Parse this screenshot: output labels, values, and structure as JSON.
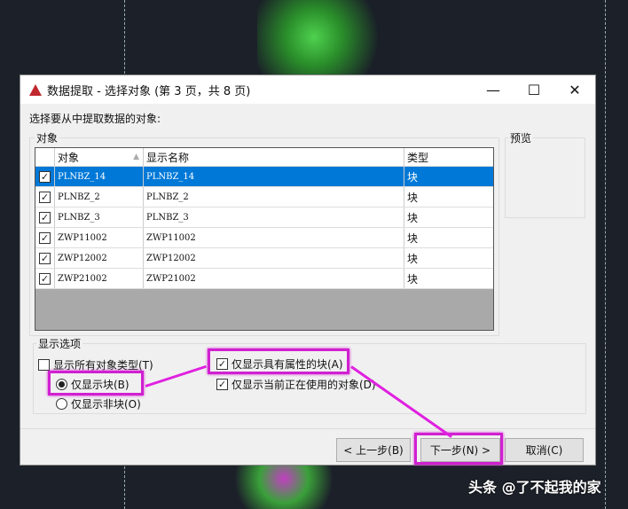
{
  "dialog": {
    "title": "数据提取 - 选择对象 (第 3 页，共 8 页)",
    "prompt": "选择要从中提取数据的对象:"
  },
  "objects_group": {
    "label": "对象",
    "columns": [
      "对象",
      "显示名称",
      "类型"
    ],
    "rows": [
      {
        "checked": true,
        "object": "PLNBZ_14",
        "display": "PLNBZ_14",
        "type": "块",
        "selected": true
      },
      {
        "checked": true,
        "object": "PLNBZ_2",
        "display": "PLNBZ_2",
        "type": "块"
      },
      {
        "checked": true,
        "object": "PLNBZ_3",
        "display": "PLNBZ_3",
        "type": "块"
      },
      {
        "checked": true,
        "object": "ZWP11002",
        "display": "ZWP11002",
        "type": "块"
      },
      {
        "checked": true,
        "object": "ZWP12002",
        "display": "ZWP12002",
        "type": "块"
      },
      {
        "checked": true,
        "object": "ZWP21002",
        "display": "ZWP21002",
        "type": "块"
      }
    ]
  },
  "preview": {
    "label": "预览"
  },
  "options": {
    "label": "显示选项",
    "show_all": "显示所有对象类型(T)",
    "blocks_only": "仅显示块(B)",
    "non_blocks_only": "仅显示非块(O)",
    "with_attributes": "仅显示具有属性的块(A)",
    "in_use": "仅显示当前正在使用的对象(D)"
  },
  "buttons": {
    "prev": "< 上一步(B)",
    "next": "下一步(N) >",
    "cancel": "取消(C)"
  },
  "watermark": "头条 @了不起我的家"
}
